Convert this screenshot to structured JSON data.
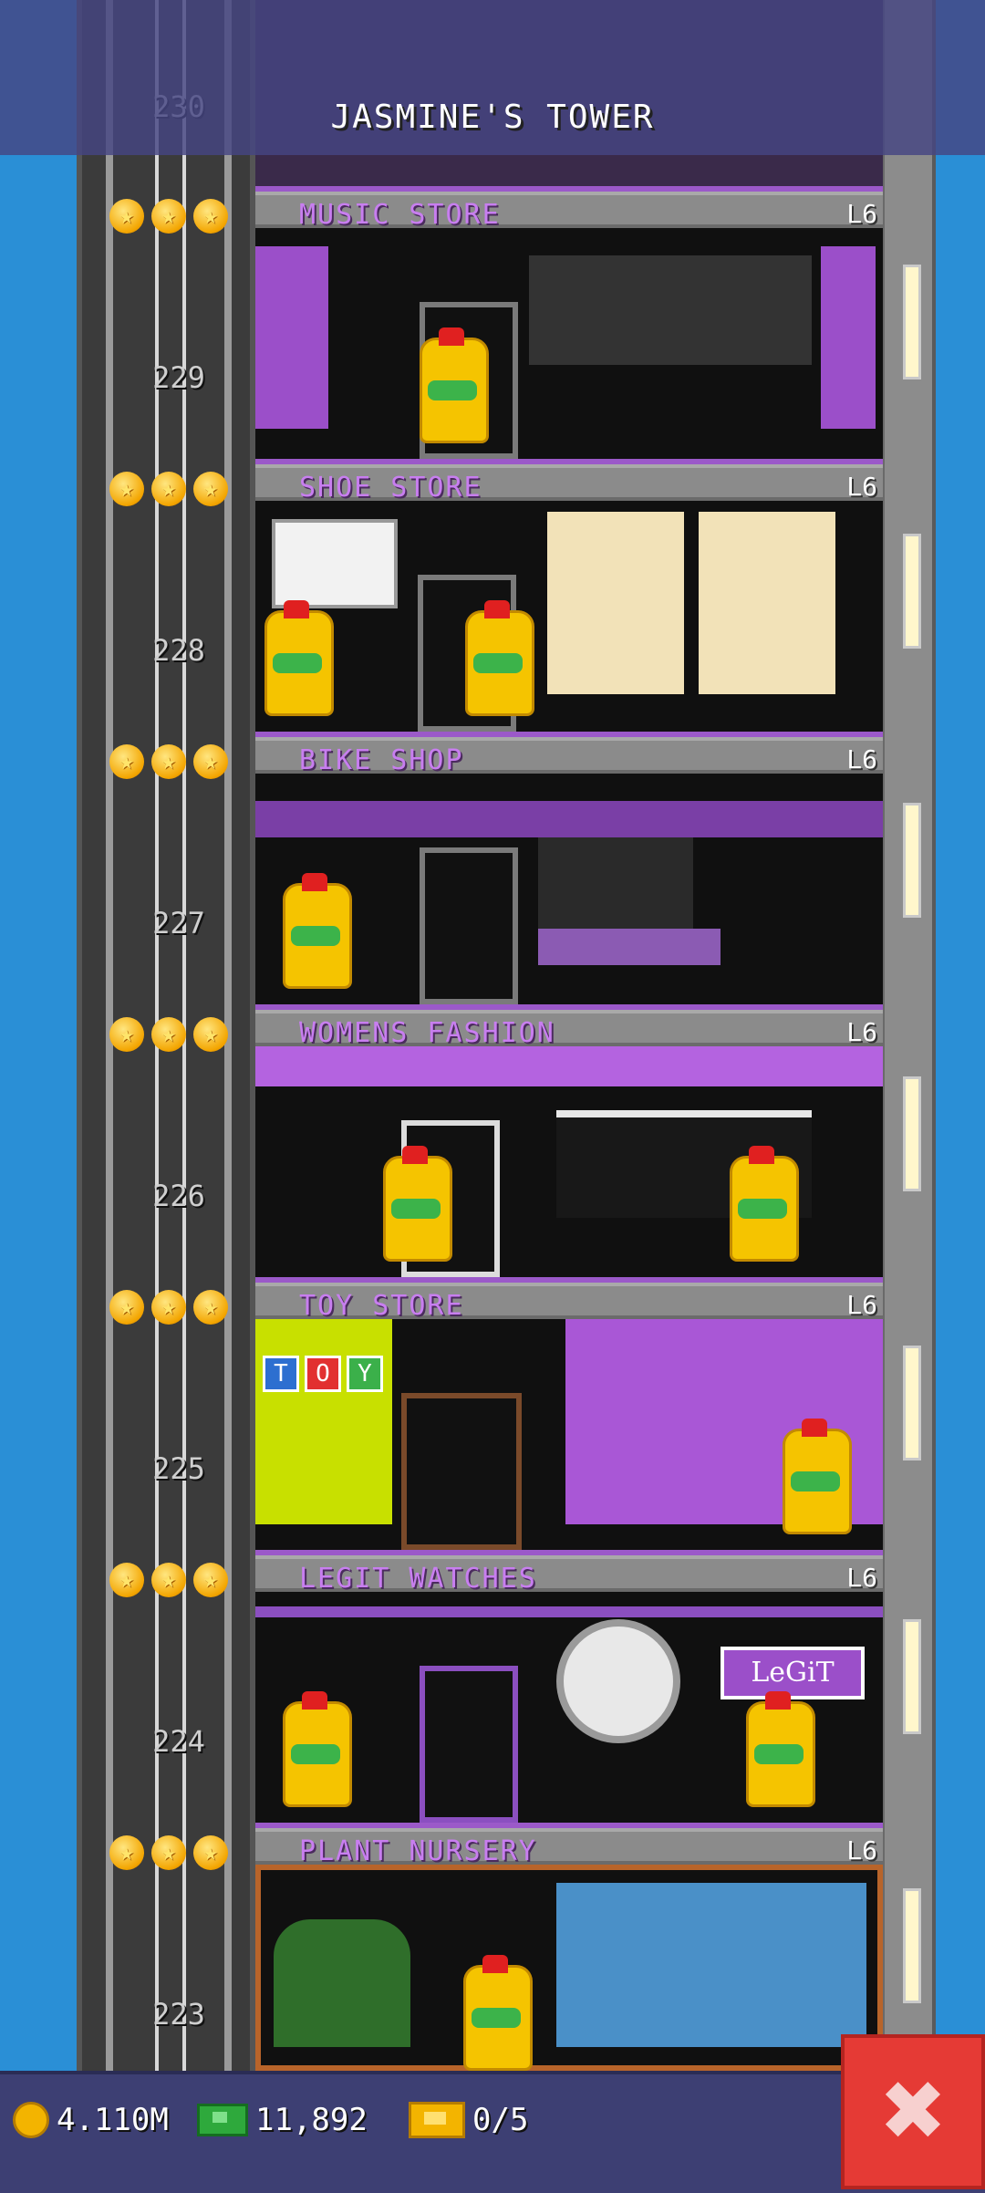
{
  "header": {
    "tower_title": "JASMINE'S TOWER"
  },
  "top_floor_number": "230",
  "floors": [
    {
      "floor_number": "229",
      "name": "MUSIC STORE",
      "level": "L6",
      "stars": 3
    },
    {
      "floor_number": "228",
      "name": "SHOE STORE",
      "level": "L6",
      "stars": 3
    },
    {
      "floor_number": "227",
      "name": "BIKE SHOP",
      "level": "L6",
      "stars": 3
    },
    {
      "floor_number": "226",
      "name": "WOMENS FASHION",
      "level": "L6",
      "stars": 3
    },
    {
      "floor_number": "225",
      "name": "TOY STORE",
      "level": "L6",
      "stars": 3
    },
    {
      "floor_number": "224",
      "name": "LEGIT WATCHES",
      "level": "L6",
      "stars": 3
    },
    {
      "floor_number": "223",
      "name": "PLANT NURSERY",
      "level": "L6",
      "stars": 3
    }
  ],
  "room_signs": {
    "toy_blocks": [
      "T",
      "O",
      "Y"
    ],
    "legit_logo": "LeGiT"
  },
  "status_bar": {
    "coins": "4.110M",
    "bux": "11,892",
    "tickets": "0/5"
  },
  "colors": {
    "sky": "#2a8fd6",
    "floor_name": "#c87ef0",
    "close_button": "#e53a35",
    "bottom_bar": "#3d3f73"
  },
  "icons": {
    "coin": "coin-icon",
    "bux": "bux-icon",
    "tickets": "ticket-icon",
    "close": "close-icon",
    "star": "star-icon"
  }
}
